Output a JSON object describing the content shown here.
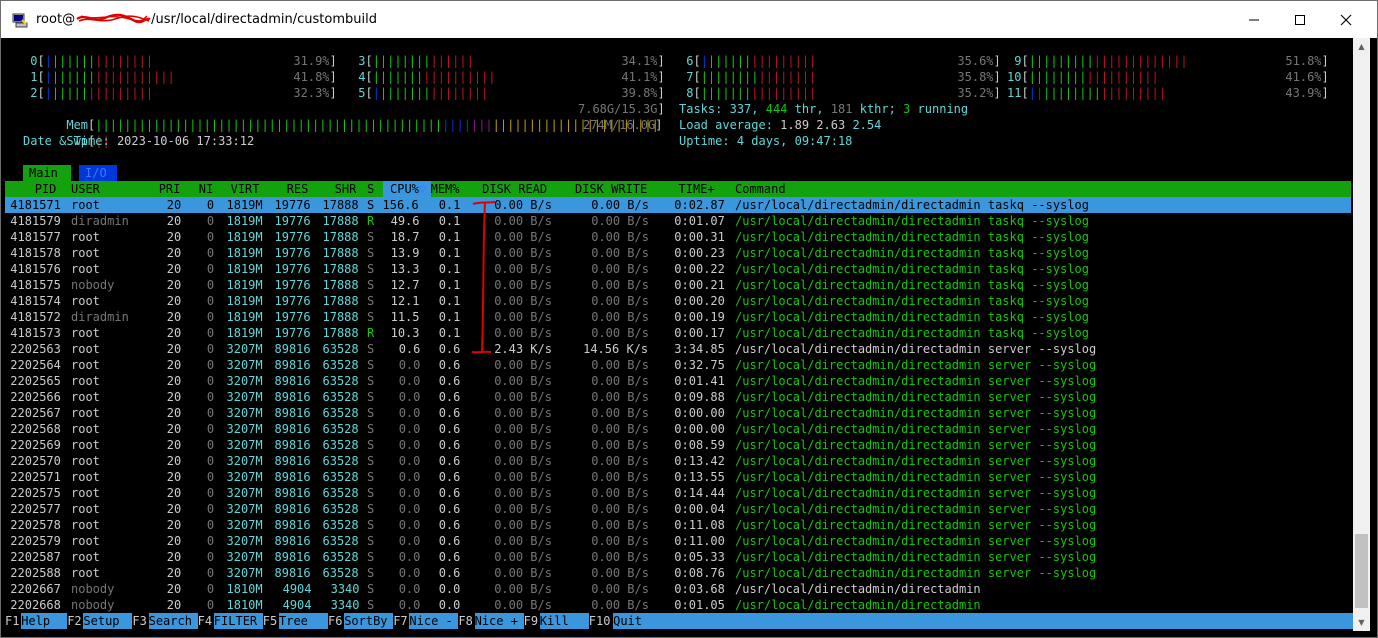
{
  "window": {
    "title_prefix": "root@",
    "title_suffix": "/usr/local/directadmin/custombuild"
  },
  "cpus": [
    {
      "id": "0",
      "pct": "31.9%",
      "bars": [
        {
          "c": "blue",
          "n": 1
        },
        {
          "c": "lgreen",
          "n": 6
        },
        {
          "c": "red",
          "n": 8
        }
      ]
    },
    {
      "id": "1",
      "pct": "41.8%",
      "bars": [
        {
          "c": "blue",
          "n": 1
        },
        {
          "c": "lgreen",
          "n": 6
        },
        {
          "c": "red",
          "n": 11
        }
      ]
    },
    {
      "id": "2",
      "pct": "32.3%",
      "bars": [
        {
          "c": "blue",
          "n": 1
        },
        {
          "c": "lgreen",
          "n": 5
        },
        {
          "c": "red",
          "n": 9
        }
      ]
    },
    {
      "id": "3",
      "pct": "34.1%",
      "bars": [
        {
          "c": "lgreen",
          "n": 8
        },
        {
          "c": "red",
          "n": 6
        }
      ]
    },
    {
      "id": "4",
      "pct": "41.1%",
      "bars": [
        {
          "c": "lgreen",
          "n": 7
        },
        {
          "c": "red",
          "n": 10
        }
      ]
    },
    {
      "id": "5",
      "pct": "39.8%",
      "bars": [
        {
          "c": "blue",
          "n": 1
        },
        {
          "c": "lgreen",
          "n": 7
        },
        {
          "c": "red",
          "n": 8
        }
      ]
    },
    {
      "id": "6",
      "pct": "35.6%",
      "bars": [
        {
          "c": "blue",
          "n": 1
        },
        {
          "c": "lgreen",
          "n": 6
        },
        {
          "c": "red",
          "n": 9
        }
      ]
    },
    {
      "id": "7",
      "pct": "35.8%",
      "bars": [
        {
          "c": "lgreen",
          "n": 8
        },
        {
          "c": "red",
          "n": 8
        }
      ]
    },
    {
      "id": "8",
      "pct": "35.2%",
      "bars": [
        {
          "c": "lgreen",
          "n": 7
        },
        {
          "c": "red",
          "n": 9
        }
      ]
    },
    {
      "id": "9",
      "pct": "51.8%",
      "bars": [
        {
          "c": "lgreen",
          "n": 9
        },
        {
          "c": "red",
          "n": 13
        }
      ]
    },
    {
      "id": "10",
      "pct": "41.6%",
      "bars": [
        {
          "c": "lgreen",
          "n": 8
        },
        {
          "c": "red",
          "n": 10
        }
      ]
    },
    {
      "id": "11",
      "pct": "43.9%",
      "bars": [
        {
          "c": "blue",
          "n": 2
        },
        {
          "c": "lgreen",
          "n": 8
        },
        {
          "c": "red",
          "n": 9
        }
      ]
    }
  ],
  "mem": {
    "label": "Mem",
    "value": "7.68G/15.3G",
    "bars": [
      {
        "c": "lgreen",
        "n": 48
      },
      {
        "c": "blue",
        "n": 4
      },
      {
        "c": "magenta",
        "n": 3
      },
      {
        "c": "yellow",
        "n": 23
      }
    ]
  },
  "swp": {
    "label": "Swp",
    "value": "274M/16.0G",
    "bars": [
      {
        "c": "red",
        "n": 2
      }
    ]
  },
  "datetime": {
    "label": "Date & Time:",
    "value": "2023-10-06 17:33:12"
  },
  "tasks": {
    "label": "Tasks:",
    "tasks": "337,",
    "thr": "444",
    "thr_label": "thr,",
    "kthr": "181",
    "kthr_label": "kthr;",
    "running": "3",
    "running_label": "running"
  },
  "load": {
    "label": "Load average:",
    "v1": "1.89",
    "v5": "2.63",
    "v15": "2.54"
  },
  "uptime": {
    "label": "Uptime:",
    "value": "4 days, 09:47:18"
  },
  "tabs": {
    "main": "Main",
    "io": "I/O"
  },
  "columns": [
    "PID",
    "USER",
    "PRI",
    "NI",
    "VIRT",
    "RES",
    "SHR",
    "S",
    "CPU%",
    "▽",
    "MEM%",
    "DISK READ",
    "DISK WRITE",
    "TIME+",
    "Command"
  ],
  "processes": [
    {
      "pid": "4181571",
      "user": "root",
      "pri": "20",
      "ni": "0",
      "virt": "1819M",
      "res": "19776",
      "shr": "17888",
      "s": "S",
      "cpu": "156.6",
      "mem": "0.1",
      "dread": "0.00 B/s",
      "dwrite": "0.00 B/s",
      "time": "0:02.87",
      "cmd": "/usr/local/directadmin/directadmin taskq --syslog",
      "selected": true,
      "thread": false
    },
    {
      "pid": "4181579",
      "user": "diradmin",
      "pri": "20",
      "ni": "0",
      "virt": "1819M",
      "res": "19776",
      "shr": "17888",
      "s": "R",
      "cpu": "49.6",
      "mem": "0.1",
      "dread": "0.00 B/s",
      "dwrite": "0.00 B/s",
      "time": "0:01.07",
      "cmd": "/usr/local/directadmin/directadmin taskq --syslog",
      "thread": true
    },
    {
      "pid": "4181577",
      "user": "root",
      "pri": "20",
      "ni": "0",
      "virt": "1819M",
      "res": "19776",
      "shr": "17888",
      "s": "S",
      "cpu": "18.7",
      "mem": "0.1",
      "dread": "0.00 B/s",
      "dwrite": "0.00 B/s",
      "time": "0:00.31",
      "cmd": "/usr/local/directadmin/directadmin taskq --syslog",
      "thread": true
    },
    {
      "pid": "4181578",
      "user": "root",
      "pri": "20",
      "ni": "0",
      "virt": "1819M",
      "res": "19776",
      "shr": "17888",
      "s": "S",
      "cpu": "13.9",
      "mem": "0.1",
      "dread": "0.00 B/s",
      "dwrite": "0.00 B/s",
      "time": "0:00.23",
      "cmd": "/usr/local/directadmin/directadmin taskq --syslog",
      "thread": true
    },
    {
      "pid": "4181576",
      "user": "root",
      "pri": "20",
      "ni": "0",
      "virt": "1819M",
      "res": "19776",
      "shr": "17888",
      "s": "S",
      "cpu": "13.3",
      "mem": "0.1",
      "dread": "0.00 B/s",
      "dwrite": "0.00 B/s",
      "time": "0:00.22",
      "cmd": "/usr/local/directadmin/directadmin taskq --syslog",
      "thread": true
    },
    {
      "pid": "4181575",
      "user": "nobody",
      "pri": "20",
      "ni": "0",
      "virt": "1819M",
      "res": "19776",
      "shr": "17888",
      "s": "S",
      "cpu": "12.7",
      "mem": "0.1",
      "dread": "0.00 B/s",
      "dwrite": "0.00 B/s",
      "time": "0:00.21",
      "cmd": "/usr/local/directadmin/directadmin taskq --syslog",
      "thread": true
    },
    {
      "pid": "4181574",
      "user": "root",
      "pri": "20",
      "ni": "0",
      "virt": "1819M",
      "res": "19776",
      "shr": "17888",
      "s": "S",
      "cpu": "12.1",
      "mem": "0.1",
      "dread": "0.00 B/s",
      "dwrite": "0.00 B/s",
      "time": "0:00.20",
      "cmd": "/usr/local/directadmin/directadmin taskq --syslog",
      "thread": true
    },
    {
      "pid": "4181572",
      "user": "diradmin",
      "pri": "20",
      "ni": "0",
      "virt": "1819M",
      "res": "19776",
      "shr": "17888",
      "s": "S",
      "cpu": "11.5",
      "mem": "0.1",
      "dread": "0.00 B/s",
      "dwrite": "0.00 B/s",
      "time": "0:00.19",
      "cmd": "/usr/local/directadmin/directadmin taskq --syslog",
      "thread": true
    },
    {
      "pid": "4181573",
      "user": "root",
      "pri": "20",
      "ni": "0",
      "virt": "1819M",
      "res": "19776",
      "shr": "17888",
      "s": "R",
      "cpu": "10.3",
      "mem": "0.1",
      "dread": "0.00 B/s",
      "dwrite": "0.00 B/s",
      "time": "0:00.17",
      "cmd": "/usr/local/directadmin/directadmin taskq --syslog",
      "thread": true
    },
    {
      "pid": "2202563",
      "user": "root",
      "pri": "20",
      "ni": "0",
      "virt": "3207M",
      "res": "89816",
      "shr": "63528",
      "s": "S",
      "cpu": "0.6",
      "mem": "0.6",
      "dread": "2.43 K/s",
      "dwrite": "14.56 K/s",
      "time": "3:34.85",
      "cmd": "/usr/local/directadmin/directadmin server --syslog",
      "thread": false
    },
    {
      "pid": "2202564",
      "user": "root",
      "pri": "20",
      "ni": "0",
      "virt": "3207M",
      "res": "89816",
      "shr": "63528",
      "s": "S",
      "cpu": "0.0",
      "mem": "0.6",
      "dread": "0.00 B/s",
      "dwrite": "0.00 B/s",
      "time": "0:32.75",
      "cmd": "/usr/local/directadmin/directadmin server --syslog",
      "thread": true
    },
    {
      "pid": "2202565",
      "user": "root",
      "pri": "20",
      "ni": "0",
      "virt": "3207M",
      "res": "89816",
      "shr": "63528",
      "s": "S",
      "cpu": "0.0",
      "mem": "0.6",
      "dread": "0.00 B/s",
      "dwrite": "0.00 B/s",
      "time": "0:01.41",
      "cmd": "/usr/local/directadmin/directadmin server --syslog",
      "thread": true
    },
    {
      "pid": "2202566",
      "user": "root",
      "pri": "20",
      "ni": "0",
      "virt": "3207M",
      "res": "89816",
      "shr": "63528",
      "s": "S",
      "cpu": "0.0",
      "mem": "0.6",
      "dread": "0.00 B/s",
      "dwrite": "0.00 B/s",
      "time": "0:09.88",
      "cmd": "/usr/local/directadmin/directadmin server --syslog",
      "thread": true
    },
    {
      "pid": "2202567",
      "user": "root",
      "pri": "20",
      "ni": "0",
      "virt": "3207M",
      "res": "89816",
      "shr": "63528",
      "s": "S",
      "cpu": "0.0",
      "mem": "0.6",
      "dread": "0.00 B/s",
      "dwrite": "0.00 B/s",
      "time": "0:00.00",
      "cmd": "/usr/local/directadmin/directadmin server --syslog",
      "thread": true
    },
    {
      "pid": "2202568",
      "user": "root",
      "pri": "20",
      "ni": "0",
      "virt": "3207M",
      "res": "89816",
      "shr": "63528",
      "s": "S",
      "cpu": "0.0",
      "mem": "0.6",
      "dread": "0.00 B/s",
      "dwrite": "0.00 B/s",
      "time": "0:00.00",
      "cmd": "/usr/local/directadmin/directadmin server --syslog",
      "thread": true
    },
    {
      "pid": "2202569",
      "user": "root",
      "pri": "20",
      "ni": "0",
      "virt": "3207M",
      "res": "89816",
      "shr": "63528",
      "s": "S",
      "cpu": "0.0",
      "mem": "0.6",
      "dread": "0.00 B/s",
      "dwrite": "0.00 B/s",
      "time": "0:08.59",
      "cmd": "/usr/local/directadmin/directadmin server --syslog",
      "thread": true
    },
    {
      "pid": "2202570",
      "user": "root",
      "pri": "20",
      "ni": "0",
      "virt": "3207M",
      "res": "89816",
      "shr": "63528",
      "s": "S",
      "cpu": "0.0",
      "mem": "0.6",
      "dread": "0.00 B/s",
      "dwrite": "0.00 B/s",
      "time": "0:13.42",
      "cmd": "/usr/local/directadmin/directadmin server --syslog",
      "thread": true
    },
    {
      "pid": "2202571",
      "user": "root",
      "pri": "20",
      "ni": "0",
      "virt": "3207M",
      "res": "89816",
      "shr": "63528",
      "s": "S",
      "cpu": "0.0",
      "mem": "0.6",
      "dread": "0.00 B/s",
      "dwrite": "0.00 B/s",
      "time": "0:13.55",
      "cmd": "/usr/local/directadmin/directadmin server --syslog",
      "thread": true
    },
    {
      "pid": "2202575",
      "user": "root",
      "pri": "20",
      "ni": "0",
      "virt": "3207M",
      "res": "89816",
      "shr": "63528",
      "s": "S",
      "cpu": "0.0",
      "mem": "0.6",
      "dread": "0.00 B/s",
      "dwrite": "0.00 B/s",
      "time": "0:14.44",
      "cmd": "/usr/local/directadmin/directadmin server --syslog",
      "thread": true
    },
    {
      "pid": "2202577",
      "user": "root",
      "pri": "20",
      "ni": "0",
      "virt": "3207M",
      "res": "89816",
      "shr": "63528",
      "s": "S",
      "cpu": "0.0",
      "mem": "0.6",
      "dread": "0.00 B/s",
      "dwrite": "0.00 B/s",
      "time": "0:00.04",
      "cmd": "/usr/local/directadmin/directadmin server --syslog",
      "thread": true
    },
    {
      "pid": "2202578",
      "user": "root",
      "pri": "20",
      "ni": "0",
      "virt": "3207M",
      "res": "89816",
      "shr": "63528",
      "s": "S",
      "cpu": "0.0",
      "mem": "0.6",
      "dread": "0.00 B/s",
      "dwrite": "0.00 B/s",
      "time": "0:11.08",
      "cmd": "/usr/local/directadmin/directadmin server --syslog",
      "thread": true
    },
    {
      "pid": "2202579",
      "user": "root",
      "pri": "20",
      "ni": "0",
      "virt": "3207M",
      "res": "89816",
      "shr": "63528",
      "s": "S",
      "cpu": "0.0",
      "mem": "0.6",
      "dread": "0.00 B/s",
      "dwrite": "0.00 B/s",
      "time": "0:11.00",
      "cmd": "/usr/local/directadmin/directadmin server --syslog",
      "thread": true
    },
    {
      "pid": "2202587",
      "user": "root",
      "pri": "20",
      "ni": "0",
      "virt": "3207M",
      "res": "89816",
      "shr": "63528",
      "s": "S",
      "cpu": "0.0",
      "mem": "0.6",
      "dread": "0.00 B/s",
      "dwrite": "0.00 B/s",
      "time": "0:05.33",
      "cmd": "/usr/local/directadmin/directadmin server --syslog",
      "thread": true
    },
    {
      "pid": "2202588",
      "user": "root",
      "pri": "20",
      "ni": "0",
      "virt": "3207M",
      "res": "89816",
      "shr": "63528",
      "s": "S",
      "cpu": "0.0",
      "mem": "0.6",
      "dread": "0.00 B/s",
      "dwrite": "0.00 B/s",
      "time": "0:08.76",
      "cmd": "/usr/local/directadmin/directadmin server --syslog",
      "thread": true
    },
    {
      "pid": "2202667",
      "user": "nobody",
      "pri": "20",
      "ni": "0",
      "virt": "1810M",
      "res": "4904",
      "shr": "3340",
      "s": "S",
      "cpu": "0.0",
      "mem": "0.0",
      "dread": "0.00 B/s",
      "dwrite": "0.00 B/s",
      "time": "0:03.68",
      "cmd": "/usr/local/directadmin/directadmin",
      "thread": false
    },
    {
      "pid": "2202668",
      "user": "nobody",
      "pri": "20",
      "ni": "0",
      "virt": "1810M",
      "res": "4904",
      "shr": "3340",
      "s": "S",
      "cpu": "0.0",
      "mem": "0.0",
      "dread": "0.00 B/s",
      "dwrite": "0.00 B/s",
      "time": "0:01.05",
      "cmd": "/usr/local/directadmin/directadmin",
      "thread": true
    }
  ],
  "footer": [
    {
      "key": "F1",
      "label": "Help"
    },
    {
      "key": "F2",
      "label": "Setup"
    },
    {
      "key": "F3",
      "label": "Search"
    },
    {
      "key": "F4",
      "label": "FILTER"
    },
    {
      "key": "F5",
      "label": "Tree"
    },
    {
      "key": "F6",
      "label": "SortBy"
    },
    {
      "key": "F7",
      "label": "Nice -"
    },
    {
      "key": "F8",
      "label": "Nice +"
    },
    {
      "key": "F9",
      "label": "Kill"
    },
    {
      "key": "F10",
      "label": "Quit"
    }
  ]
}
